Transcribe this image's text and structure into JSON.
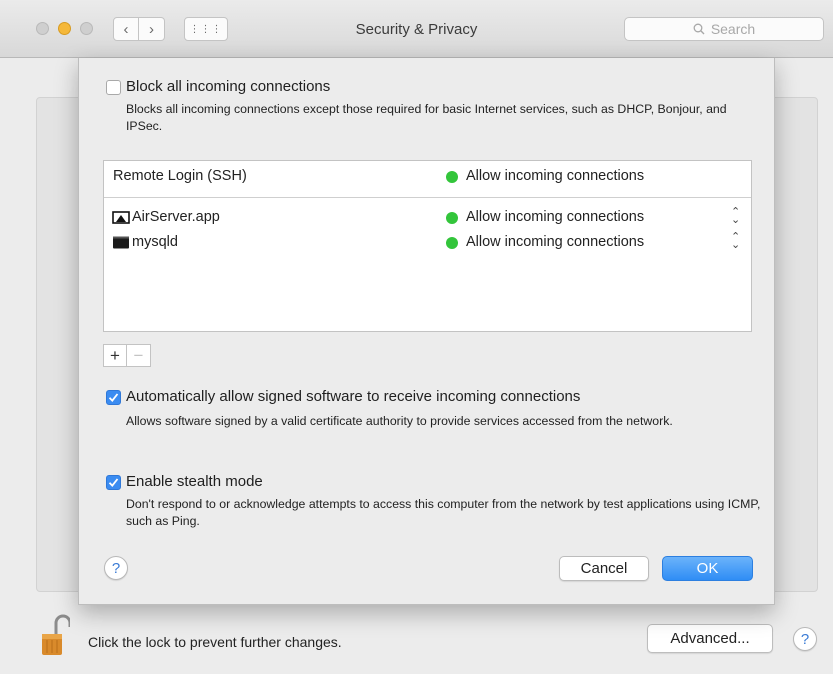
{
  "window": {
    "title": "Security & Privacy",
    "search_placeholder": "Search",
    "nav_back_icon": "‹",
    "nav_forward_icon": "›",
    "grid_icon": "⋮⋮⋮"
  },
  "sheet": {
    "block_all": {
      "label": "Block all incoming connections",
      "checked": false,
      "description": "Blocks all incoming connections except those required for basic Internet services,  such as DHCP, Bonjour, and IPSec."
    },
    "list": {
      "service_row": {
        "name": "Remote Login (SSH)",
        "status": "Allow incoming connections"
      },
      "apps": [
        {
          "name": "AirServer.app",
          "status": "Allow incoming connections",
          "icon": "airplay-icon"
        },
        {
          "name": "mysqld",
          "status": "Allow incoming connections",
          "icon": "terminal-icon"
        }
      ],
      "status_color": "#33c53b"
    },
    "add_label": "+",
    "remove_label": "−",
    "auto_allow": {
      "label": "Automatically allow signed software to receive incoming connections",
      "checked": true,
      "description": "Allows software signed by a valid certificate authority to provide services accessed from the network."
    },
    "stealth": {
      "label": "Enable stealth mode",
      "checked": true,
      "description": "Don't respond to or acknowledge attempts to access this computer from the network by test applications using ICMP, such as Ping."
    },
    "help_label": "?",
    "cancel_label": "Cancel",
    "ok_label": "OK"
  },
  "footer": {
    "lock_text": "Click the lock to prevent further changes.",
    "advanced_label": "Advanced...",
    "help_label": "?"
  },
  "colors": {
    "accent": "#3b8cf1",
    "ok_button": "#2f8df5"
  }
}
